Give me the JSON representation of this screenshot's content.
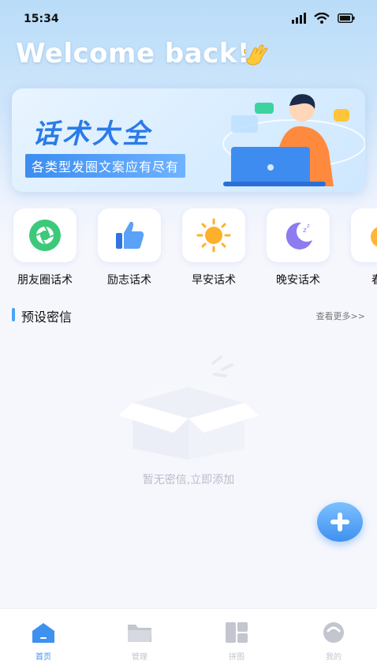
{
  "status": {
    "time": "15:34"
  },
  "header": {
    "welcome": "Welcome back!"
  },
  "banner": {
    "title": "话术大全",
    "subtitle": "各类型发圈文案应有尽有"
  },
  "categories": [
    {
      "label": "朋友圈话术",
      "icon": "aperture-icon",
      "color": "#3cc97a"
    },
    {
      "label": "励志话术",
      "icon": "thumbs-up-icon",
      "color": "#4a8ff2"
    },
    {
      "label": "早安话术",
      "icon": "sun-icon",
      "color": "#ffb02a"
    },
    {
      "label": "晚安话术",
      "icon": "moon-icon",
      "color": "#8c7cf0"
    },
    {
      "label": "春节",
      "icon": "lantern-icon",
      "color": "#ffb43a"
    }
  ],
  "section": {
    "title": "预设密信",
    "more": "查看更多>>"
  },
  "empty": {
    "text": "暂无密信,立即添加"
  },
  "tabs": [
    {
      "label": "首页",
      "active": true
    },
    {
      "label": "管理",
      "active": false
    },
    {
      "label": "拼图",
      "active": false
    },
    {
      "label": "我的",
      "active": false
    }
  ],
  "colors": {
    "accent": "#3f91f0",
    "inactive": "#c3c6cf"
  }
}
